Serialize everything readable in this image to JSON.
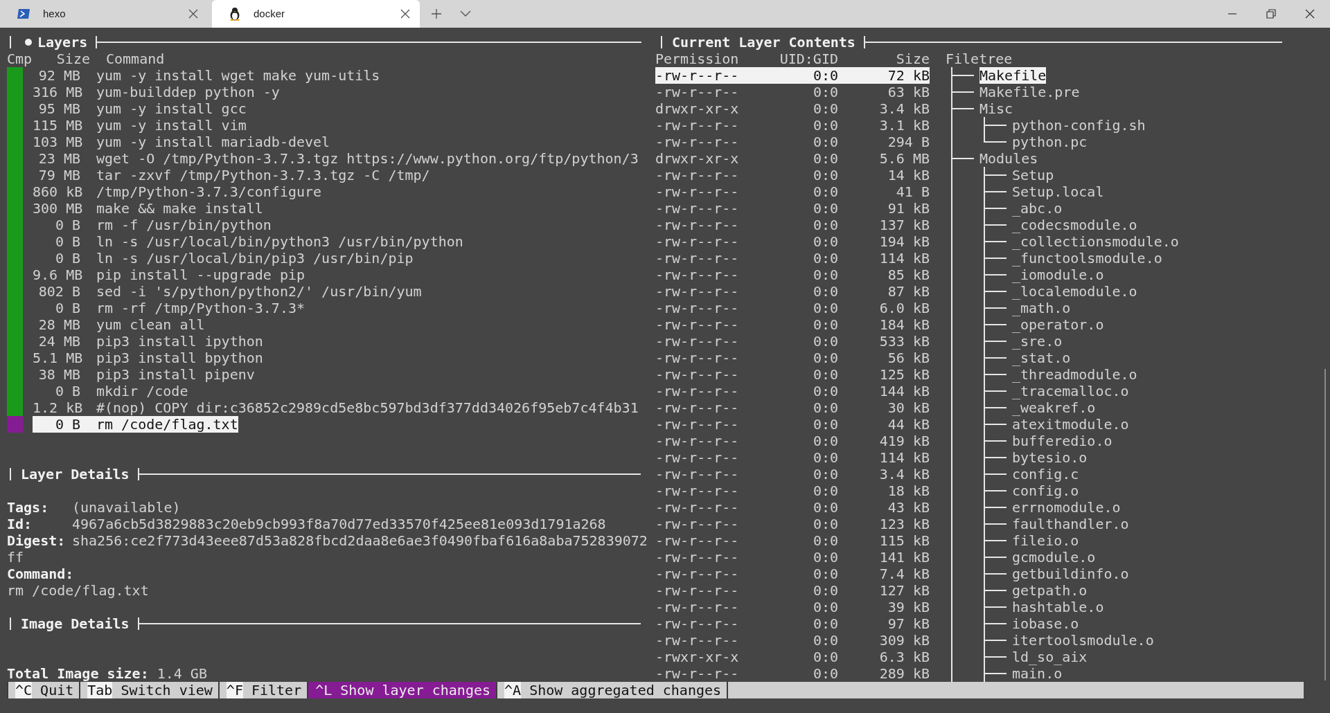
{
  "tabs": [
    {
      "title": "hexo",
      "selected": false
    },
    {
      "title": "docker",
      "selected": true
    }
  ],
  "layers_pane": {
    "title": "Layers",
    "active": true,
    "columns": [
      "Cmp",
      "Size",
      "Command"
    ],
    "rows": [
      {
        "size": "92 MB",
        "command": "yum -y install wget make yum-utils",
        "color": "#1a9a1a",
        "selected": false
      },
      {
        "size": "316 MB",
        "command": "yum-builddep python -y",
        "color": "#1a9a1a",
        "selected": false
      },
      {
        "size": "95 MB",
        "command": "yum -y install gcc",
        "color": "#1a9a1a",
        "selected": false
      },
      {
        "size": "115 MB",
        "command": "yum -y install vim",
        "color": "#1a9a1a",
        "selected": false
      },
      {
        "size": "103 MB",
        "command": "yum -y install mariadb-devel",
        "color": "#1a9a1a",
        "selected": false
      },
      {
        "size": "23 MB",
        "command": "wget -O /tmp/Python-3.7.3.tgz https://www.python.org/ftp/python/3",
        "color": "#1a9a1a",
        "selected": false
      },
      {
        "size": "79 MB",
        "command": "tar -zxvf /tmp/Python-3.7.3.tgz -C /tmp/",
        "color": "#1a9a1a",
        "selected": false
      },
      {
        "size": "860 kB",
        "command": "/tmp/Python-3.7.3/configure",
        "color": "#1a9a1a",
        "selected": false
      },
      {
        "size": "300 MB",
        "command": "make && make install",
        "color": "#1a9a1a",
        "selected": false
      },
      {
        "size": "0 B",
        "command": "rm -f /usr/bin/python",
        "color": "#1a9a1a",
        "selected": false
      },
      {
        "size": "0 B",
        "command": "ln -s /usr/local/bin/python3 /usr/bin/python",
        "color": "#1a9a1a",
        "selected": false
      },
      {
        "size": "0 B",
        "command": "ln -s /usr/local/bin/pip3 /usr/bin/pip",
        "color": "#1a9a1a",
        "selected": false
      },
      {
        "size": "9.6 MB",
        "command": "pip install --upgrade pip",
        "color": "#1a9a1a",
        "selected": false
      },
      {
        "size": "802 B",
        "command": "sed -i 's/python/python2/' /usr/bin/yum",
        "color": "#1a9a1a",
        "selected": false
      },
      {
        "size": "0 B",
        "command": "rm -rf /tmp/Python-3.7.3*",
        "color": "#1a9a1a",
        "selected": false
      },
      {
        "size": "28 MB",
        "command": "yum clean all",
        "color": "#1a9a1a",
        "selected": false
      },
      {
        "size": "24 MB",
        "command": "pip3 install ipython",
        "color": "#1a9a1a",
        "selected": false
      },
      {
        "size": "5.1 MB",
        "command": "pip3 install bpython",
        "color": "#1a9a1a",
        "selected": false
      },
      {
        "size": "38 MB",
        "command": "pip3 install pipenv",
        "color": "#1a9a1a",
        "selected": false
      },
      {
        "size": "0 B",
        "command": "mkdir /code",
        "color": "#1a9a1a",
        "selected": false
      },
      {
        "size": "1.2 kB",
        "command": "#(nop) COPY dir:c36852c2989cd5e8bc597bd3df377dd34026f95eb7c4f4b31",
        "color": "#1a9a1a",
        "selected": false
      },
      {
        "size": "0 B",
        "command": "rm /code/flag.txt",
        "color": "#861c93",
        "selected": true
      }
    ]
  },
  "layer_details": {
    "title": "Layer Details",
    "fields": [
      {
        "label": "Tags:",
        "lines": [
          "(unavailable)"
        ]
      },
      {
        "label": "Id:",
        "lines": [
          "4967a6cb5d3829883c20eb9cb993f8a70d77ed33570f425ee81e093d1791a268"
        ]
      },
      {
        "label": "Digest:",
        "lines": [
          "sha256:ce2f773d43eee87d53a828fbcd2daa8e6ae3f0490fbaf616a8aba752839072",
          "ff"
        ]
      }
    ],
    "command_label": "Command:",
    "command": "rm /code/flag.txt"
  },
  "image_details": {
    "title": "Image Details",
    "total_label": "Total Image size:",
    "total": "1.4 GB"
  },
  "contents_pane": {
    "title": "Current Layer Contents",
    "columns": [
      "Permission",
      "UID:GID",
      "Size",
      "Filetree"
    ],
    "tree": [
      {
        "permission": "-rw-r--r--",
        "uid_gid": "0:0",
        "size": "72 kB",
        "name": "Makefile",
        "selected": true
      },
      {
        "permission": "-rw-r--r--",
        "uid_gid": "0:0",
        "size": "63 kB",
        "name": "Makefile.pre",
        "selected": false
      },
      {
        "permission": "drwxr-xr-x",
        "uid_gid": "0:0",
        "size": "3.4 kB",
        "name": "Misc",
        "selected": false,
        "children": [
          {
            "permission": "-rw-r--r--",
            "uid_gid": "0:0",
            "size": "3.1 kB",
            "name": "python-config.sh",
            "selected": false
          },
          {
            "permission": "-rw-r--r--",
            "uid_gid": "0:0",
            "size": "294 B",
            "name": "python.pc",
            "selected": false
          }
        ]
      },
      {
        "permission": "drwxr-xr-x",
        "uid_gid": "0:0",
        "size": "5.6 MB",
        "name": "Modules",
        "selected": false,
        "continues": true,
        "children": [
          {
            "permission": "-rw-r--r--",
            "uid_gid": "0:0",
            "size": "14 kB",
            "name": "Setup",
            "selected": false
          },
          {
            "permission": "-rw-r--r--",
            "uid_gid": "0:0",
            "size": "41 B",
            "name": "Setup.local",
            "selected": false
          },
          {
            "permission": "-rw-r--r--",
            "uid_gid": "0:0",
            "size": "91 kB",
            "name": "_abc.o",
            "selected": false
          },
          {
            "permission": "-rw-r--r--",
            "uid_gid": "0:0",
            "size": "137 kB",
            "name": "_codecsmodule.o",
            "selected": false
          },
          {
            "permission": "-rw-r--r--",
            "uid_gid": "0:0",
            "size": "194 kB",
            "name": "_collectionsmodule.o",
            "selected": false
          },
          {
            "permission": "-rw-r--r--",
            "uid_gid": "0:0",
            "size": "114 kB",
            "name": "_functoolsmodule.o",
            "selected": false
          },
          {
            "permission": "-rw-r--r--",
            "uid_gid": "0:0",
            "size": "85 kB",
            "name": "_iomodule.o",
            "selected": false
          },
          {
            "permission": "-rw-r--r--",
            "uid_gid": "0:0",
            "size": "87 kB",
            "name": "_localemodule.o",
            "selected": false
          },
          {
            "permission": "-rw-r--r--",
            "uid_gid": "0:0",
            "size": "6.0 kB",
            "name": "_math.o",
            "selected": false
          },
          {
            "permission": "-rw-r--r--",
            "uid_gid": "0:0",
            "size": "184 kB",
            "name": "_operator.o",
            "selected": false
          },
          {
            "permission": "-rw-r--r--",
            "uid_gid": "0:0",
            "size": "533 kB",
            "name": "_sre.o",
            "selected": false
          },
          {
            "permission": "-rw-r--r--",
            "uid_gid": "0:0",
            "size": "56 kB",
            "name": "_stat.o",
            "selected": false
          },
          {
            "permission": "-rw-r--r--",
            "uid_gid": "0:0",
            "size": "125 kB",
            "name": "_threadmodule.o",
            "selected": false
          },
          {
            "permission": "-rw-r--r--",
            "uid_gid": "0:0",
            "size": "144 kB",
            "name": "_tracemalloc.o",
            "selected": false
          },
          {
            "permission": "-rw-r--r--",
            "uid_gid": "0:0",
            "size": "30 kB",
            "name": "_weakref.o",
            "selected": false
          },
          {
            "permission": "-rw-r--r--",
            "uid_gid": "0:0",
            "size": "44 kB",
            "name": "atexitmodule.o",
            "selected": false
          },
          {
            "permission": "-rw-r--r--",
            "uid_gid": "0:0",
            "size": "419 kB",
            "name": "bufferedio.o",
            "selected": false
          },
          {
            "permission": "-rw-r--r--",
            "uid_gid": "0:0",
            "size": "114 kB",
            "name": "bytesio.o",
            "selected": false
          },
          {
            "permission": "-rw-r--r--",
            "uid_gid": "0:0",
            "size": "3.4 kB",
            "name": "config.c",
            "selected": false
          },
          {
            "permission": "-rw-r--r--",
            "uid_gid": "0:0",
            "size": "18 kB",
            "name": "config.o",
            "selected": false
          },
          {
            "permission": "-rw-r--r--",
            "uid_gid": "0:0",
            "size": "43 kB",
            "name": "errnomodule.o",
            "selected": false
          },
          {
            "permission": "-rw-r--r--",
            "uid_gid": "0:0",
            "size": "123 kB",
            "name": "faulthandler.o",
            "selected": false
          },
          {
            "permission": "-rw-r--r--",
            "uid_gid": "0:0",
            "size": "115 kB",
            "name": "fileio.o",
            "selected": false
          },
          {
            "permission": "-rw-r--r--",
            "uid_gid": "0:0",
            "size": "141 kB",
            "name": "gcmodule.o",
            "selected": false
          },
          {
            "permission": "-rw-r--r--",
            "uid_gid": "0:0",
            "size": "7.4 kB",
            "name": "getbuildinfo.o",
            "selected": false
          },
          {
            "permission": "-rw-r--r--",
            "uid_gid": "0:0",
            "size": "127 kB",
            "name": "getpath.o",
            "selected": false
          },
          {
            "permission": "-rw-r--r--",
            "uid_gid": "0:0",
            "size": "39 kB",
            "name": "hashtable.o",
            "selected": false
          },
          {
            "permission": "-rw-r--r--",
            "uid_gid": "0:0",
            "size": "97 kB",
            "name": "iobase.o",
            "selected": false
          },
          {
            "permission": "-rw-r--r--",
            "uid_gid": "0:0",
            "size": "309 kB",
            "name": "itertoolsmodule.o",
            "selected": false
          },
          {
            "permission": "-rwxr-xr-x",
            "uid_gid": "0:0",
            "size": "6.3 kB",
            "name": "ld_so_aix",
            "selected": false
          },
          {
            "permission": "-rw-r--r--",
            "uid_gid": "0:0",
            "size": "289 kB",
            "name": "main.o",
            "selected": false,
            "continues": true
          }
        ]
      }
    ]
  },
  "status_bar": [
    {
      "key": "^C",
      "label": "Quit",
      "selected": false
    },
    {
      "key": "Tab",
      "label": "Switch view",
      "selected": false
    },
    {
      "key": "^F",
      "label": "Filter",
      "selected": false
    },
    {
      "key": "^L",
      "label": "Show layer changes",
      "selected": true
    },
    {
      "key": "^A",
      "label": "Show aggregated changes",
      "selected": false
    }
  ]
}
